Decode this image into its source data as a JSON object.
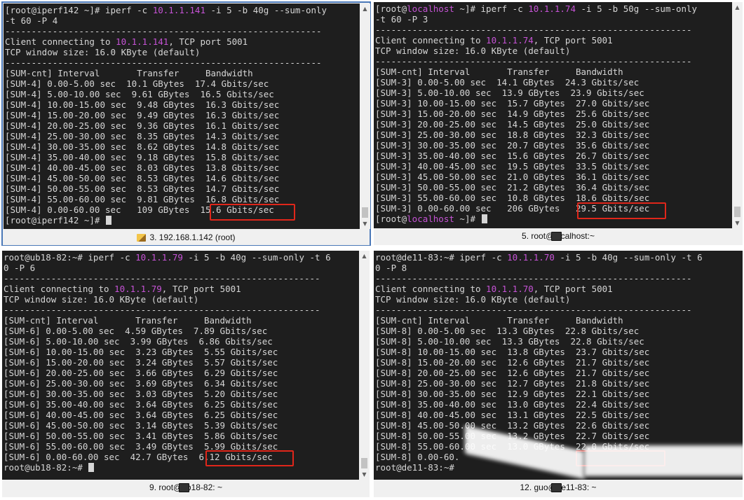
{
  "panes": [
    {
      "tab_title": "3. 192.168.1.142 (root)",
      "lines": [
        [
          {
            "t": "[root@iperf142 ~]# iperf -c "
          },
          {
            "t": "10.1.1.141",
            "ip": true
          },
          {
            "t": " -i 5 -b 40g --sum-only"
          }
        ],
        [
          {
            "t": "-t 60 -P 4"
          }
        ],
        [
          {
            "t": "------------------------------------------------------------"
          }
        ],
        [
          {
            "t": "Client connecting to "
          },
          {
            "t": "10.1.1.141",
            "ip": true
          },
          {
            "t": ", TCP port 5001"
          }
        ],
        [
          {
            "t": "TCP window size: 16.0 KByte (default)"
          }
        ],
        [
          {
            "t": "------------------------------------------------------------"
          }
        ],
        [
          {
            "t": "[SUM-cnt] Interval       Transfer     Bandwidth"
          }
        ],
        [
          {
            "t": "[SUM-4] 0.00-5.00 sec  10.1 GBytes  17.4 Gbits/sec"
          }
        ],
        [
          {
            "t": "[SUM-4] 5.00-10.00 sec  9.61 GBytes  16.5 Gbits/sec"
          }
        ],
        [
          {
            "t": "[SUM-4] 10.00-15.00 sec  9.48 GBytes  16.3 Gbits/sec"
          }
        ],
        [
          {
            "t": "[SUM-4] 15.00-20.00 sec  9.49 GBytes  16.3 Gbits/sec"
          }
        ],
        [
          {
            "t": "[SUM-4] 20.00-25.00 sec  9.36 GBytes  16.1 Gbits/sec"
          }
        ],
        [
          {
            "t": "[SUM-4] 25.00-30.00 sec  8.35 GBytes  14.3 Gbits/sec"
          }
        ],
        [
          {
            "t": "[SUM-4] 30.00-35.00 sec  8.62 GBytes  14.8 Gbits/sec"
          }
        ],
        [
          {
            "t": "[SUM-4] 35.00-40.00 sec  9.18 GBytes  15.8 Gbits/sec"
          }
        ],
        [
          {
            "t": "[SUM-4] 40.00-45.00 sec  8.03 GBytes  13.8 Gbits/sec"
          }
        ],
        [
          {
            "t": "[SUM-4] 45.00-50.00 sec  8.53 GBytes  14.6 Gbits/sec"
          }
        ],
        [
          {
            "t": "[SUM-4] 50.00-55.00 sec  8.53 GBytes  14.7 Gbits/sec"
          }
        ],
        [
          {
            "t": "[SUM-4] 55.00-60.00 sec  9.81 GBytes  16.8 Gbits/sec"
          }
        ],
        [
          {
            "t": "[SUM-4] 0.00-60.00 sec   109 GBytes  15.6 Gbits/sec"
          }
        ],
        [
          {
            "t": "[root@iperf142 ~]# "
          },
          {
            "cursor": true
          }
        ]
      ]
    },
    {
      "tab_title": "5. root@localhost:~",
      "lines": [
        [
          {
            "t": "[root@"
          },
          {
            "t": "localhost",
            "ip": true
          },
          {
            "t": " ~]# iperf -c "
          },
          {
            "t": "10.1.1.74",
            "ip": true
          },
          {
            "t": " -i 5 -b 50g --sum-only"
          }
        ],
        [
          {
            "t": "-t 60 -P 3"
          }
        ],
        [
          {
            "t": "------------------------------------------------------------"
          }
        ],
        [
          {
            "t": "Client connecting to "
          },
          {
            "t": "10.1.1.74",
            "ip": true
          },
          {
            "t": ", TCP port 5001"
          }
        ],
        [
          {
            "t": "TCP window size: 16.0 KByte (default)"
          }
        ],
        [
          {
            "t": "------------------------------------------------------------"
          }
        ],
        [
          {
            "t": "[SUM-cnt] Interval       Transfer     Bandwidth"
          }
        ],
        [
          {
            "t": "[SUM-3] 0.00-5.00 sec  14.1 GBytes  24.3 Gbits/sec"
          }
        ],
        [
          {
            "t": "[SUM-3] 5.00-10.00 sec  13.9 GBytes  23.9 Gbits/sec"
          }
        ],
        [
          {
            "t": "[SUM-3] 10.00-15.00 sec  15.7 GBytes  27.0 Gbits/sec"
          }
        ],
        [
          {
            "t": "[SUM-3] 15.00-20.00 sec  14.9 GBytes  25.6 Gbits/sec"
          }
        ],
        [
          {
            "t": "[SUM-3] 20.00-25.00 sec  14.5 GBytes  25.0 Gbits/sec"
          }
        ],
        [
          {
            "t": "[SUM-3] 25.00-30.00 sec  18.8 GBytes  32.3 Gbits/sec"
          }
        ],
        [
          {
            "t": "[SUM-3] 30.00-35.00 sec  20.7 GBytes  35.6 Gbits/sec"
          }
        ],
        [
          {
            "t": "[SUM-3] 35.00-40.00 sec  15.6 GBytes  26.7 Gbits/sec"
          }
        ],
        [
          {
            "t": "[SUM-3] 40.00-45.00 sec  19.5 GBytes  33.5 Gbits/sec"
          }
        ],
        [
          {
            "t": "[SUM-3] 45.00-50.00 sec  21.0 GBytes  36.1 Gbits/sec"
          }
        ],
        [
          {
            "t": "[SUM-3] 50.00-55.00 sec  21.2 GBytes  36.4 Gbits/sec"
          }
        ],
        [
          {
            "t": "[SUM-3] 55.00-60.00 sec  10.8 GBytes  18.6 Gbits/sec"
          }
        ],
        [
          {
            "t": "[SUM-3] 0.00-60.00 sec   206 GBytes   29.5 Gbits/sec"
          }
        ],
        [
          {
            "t": "[root@"
          },
          {
            "t": "localhost",
            "ip": true
          },
          {
            "t": " ~]# "
          },
          {
            "cursor": true
          }
        ]
      ]
    },
    {
      "tab_title": "9. root@ub18-82: ~",
      "lines": [
        [
          {
            "t": "root@ub18-82:~# iperf -c "
          },
          {
            "t": "10.1.1.79",
            "ip": true
          },
          {
            "t": " -i 5 -b 40g --sum-only -t 6"
          }
        ],
        [
          {
            "t": "0 -P 6"
          }
        ],
        [
          {
            "t": "------------------------------------------------------------"
          }
        ],
        [
          {
            "t": "Client connecting to "
          },
          {
            "t": "10.1.1.79",
            "ip": true
          },
          {
            "t": ", TCP port 5001"
          }
        ],
        [
          {
            "t": "TCP window size: 16.0 KByte (default)"
          }
        ],
        [
          {
            "t": "------------------------------------------------------------"
          }
        ],
        [
          {
            "t": "[SUM-cnt] Interval       Transfer     Bandwidth"
          }
        ],
        [
          {
            "t": "[SUM-6] 0.00-5.00 sec  4.59 GBytes  7.89 Gbits/sec"
          }
        ],
        [
          {
            "t": "[SUM-6] 5.00-10.00 sec  3.99 GBytes  6.86 Gbits/sec"
          }
        ],
        [
          {
            "t": "[SUM-6] 10.00-15.00 sec  3.23 GBytes  5.55 Gbits/sec"
          }
        ],
        [
          {
            "t": "[SUM-6] 15.00-20.00 sec  3.24 GBytes  5.57 Gbits/sec"
          }
        ],
        [
          {
            "t": "[SUM-6] 20.00-25.00 sec  3.66 GBytes  6.29 Gbits/sec"
          }
        ],
        [
          {
            "t": "[SUM-6] 25.00-30.00 sec  3.69 GBytes  6.34 Gbits/sec"
          }
        ],
        [
          {
            "t": "[SUM-6] 30.00-35.00 sec  3.03 GBytes  5.20 Gbits/sec"
          }
        ],
        [
          {
            "t": "[SUM-6] 35.00-40.00 sec  3.64 GBytes  6.25 Gbits/sec"
          }
        ],
        [
          {
            "t": "[SUM-6] 40.00-45.00 sec  3.64 GBytes  6.25 Gbits/sec"
          }
        ],
        [
          {
            "t": "[SUM-6] 45.00-50.00 sec  3.14 GBytes  5.39 Gbits/sec"
          }
        ],
        [
          {
            "t": "[SUM-6] 50.00-55.00 sec  3.41 GBytes  5.86 Gbits/sec"
          }
        ],
        [
          {
            "t": "[SUM-6] 55.00-60.00 sec  3.49 GBytes  5.99 Gbits/sec"
          }
        ],
        [
          {
            "t": "[SUM-6] 0.00-60.00 sec  42.7 GBytes  6.12 Gbits/sec"
          }
        ],
        [
          {
            "t": "root@ub18-82:~# "
          },
          {
            "cursor": true
          }
        ]
      ]
    },
    {
      "tab_title": "12. guo@de11-83: ~",
      "lines": [
        [
          {
            "t": "root@de11-83:~# iperf -c "
          },
          {
            "t": "10.1.1.70",
            "ip": true
          },
          {
            "t": " -i 5 -b 40g --sum-only -t 6"
          }
        ],
        [
          {
            "t": "0 -P 8"
          }
        ],
        [
          {
            "t": "------------------------------------------------------------"
          }
        ],
        [
          {
            "t": "Client connecting to "
          },
          {
            "t": "10.1.1.70",
            "ip": true
          },
          {
            "t": ", TCP port 5001"
          }
        ],
        [
          {
            "t": "TCP window size: 16.0 KByte (default)"
          }
        ],
        [
          {
            "t": "------------------------------------------------------------"
          }
        ],
        [
          {
            "t": "[SUM-cnt] Interval       Transfer     Bandwidth"
          }
        ],
        [
          {
            "t": "[SUM-8] 0.00-5.00 sec  13.3 GBytes  22.8 Gbits/sec"
          }
        ],
        [
          {
            "t": "[SUM-8] 5.00-10.00 sec  13.3 GBytes  22.8 Gbits/sec"
          }
        ],
        [
          {
            "t": "[SUM-8] 10.00-15.00 sec  13.8 GBytes  23.7 Gbits/sec"
          }
        ],
        [
          {
            "t": "[SUM-8] 15.00-20.00 sec  12.6 GBytes  21.7 Gbits/sec"
          }
        ],
        [
          {
            "t": "[SUM-8] 20.00-25.00 sec  12.6 GBytes  21.7 Gbits/sec"
          }
        ],
        [
          {
            "t": "[SUM-8] 25.00-30.00 sec  12.7 GBytes  21.8 Gbits/sec"
          }
        ],
        [
          {
            "t": "[SUM-8] 30.00-35.00 sec  12.9 GBytes  22.1 Gbits/sec"
          }
        ],
        [
          {
            "t": "[SUM-8] 35.00-40.00 sec  13.0 GBytes  22.4 Gbits/sec"
          }
        ],
        [
          {
            "t": "[SUM-8] 40.00-45.00 sec  13.1 GBytes  22.5 Gbits/sec"
          }
        ],
        [
          {
            "t": "[SUM-8] 45.00-50.00 sec  13.2 GBytes  22.6 Gbits/sec"
          }
        ],
        [
          {
            "t": "[SUM-8] 50.00-55.00 sec  13.2 GBytes  22.7 Gbits/sec"
          }
        ],
        [
          {
            "t": "[SUM-8] 55.00-60.00 sec  13.0 GBytes  22.0 Gbits/sec"
          }
        ],
        [
          {
            "t": "[SUM-8] 0.00-60."
          }
        ],
        [
          {
            "t": "root@de11-83:~# "
          }
        ]
      ]
    }
  ],
  "colors": {
    "terminal_bg": "#1e1e1e",
    "terminal_fg": "#d6d6d6",
    "ip_highlight": "#c653d6",
    "annotation_box": "#e0261a",
    "active_border": "#4a78b8"
  },
  "icons": {
    "pane0_tab_icon": "pencil-icon",
    "other_tab_icon": "terminal-icon"
  }
}
